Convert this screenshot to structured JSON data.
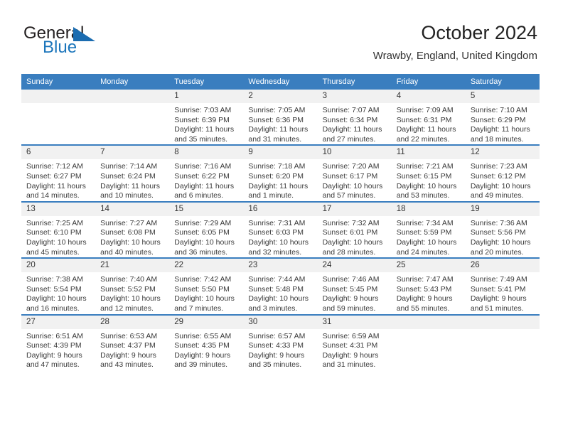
{
  "brand": {
    "name_part1": "General",
    "name_part2": "Blue",
    "accent_color": "#1b75bb"
  },
  "header": {
    "title": "October 2024",
    "subtitle": "Wrawby, England, United Kingdom",
    "header_bg_color": "#3a7ebf",
    "daynum_bg_color": "#f1f1f1"
  },
  "weekday_headers": [
    "Sunday",
    "Monday",
    "Tuesday",
    "Wednesday",
    "Thursday",
    "Friday",
    "Saturday"
  ],
  "labels": {
    "sunrise_prefix": "Sunrise:",
    "sunset_prefix": "Sunset:",
    "daylight_prefix": "Daylight:"
  },
  "weeks": [
    [
      {
        "day": "",
        "blank": true,
        "sunrise": "",
        "sunset": "",
        "daylight_a": "",
        "daylight_b": ""
      },
      {
        "day": "",
        "blank": true,
        "sunrise": "",
        "sunset": "",
        "daylight_a": "",
        "daylight_b": ""
      },
      {
        "day": "1",
        "blank": false,
        "sunrise": "Sunrise: 7:03 AM",
        "sunset": "Sunset: 6:39 PM",
        "daylight_a": "Daylight: 11 hours",
        "daylight_b": "and 35 minutes."
      },
      {
        "day": "2",
        "blank": false,
        "sunrise": "Sunrise: 7:05 AM",
        "sunset": "Sunset: 6:36 PM",
        "daylight_a": "Daylight: 11 hours",
        "daylight_b": "and 31 minutes."
      },
      {
        "day": "3",
        "blank": false,
        "sunrise": "Sunrise: 7:07 AM",
        "sunset": "Sunset: 6:34 PM",
        "daylight_a": "Daylight: 11 hours",
        "daylight_b": "and 27 minutes."
      },
      {
        "day": "4",
        "blank": false,
        "sunrise": "Sunrise: 7:09 AM",
        "sunset": "Sunset: 6:31 PM",
        "daylight_a": "Daylight: 11 hours",
        "daylight_b": "and 22 minutes."
      },
      {
        "day": "5",
        "blank": false,
        "sunrise": "Sunrise: 7:10 AM",
        "sunset": "Sunset: 6:29 PM",
        "daylight_a": "Daylight: 11 hours",
        "daylight_b": "and 18 minutes."
      }
    ],
    [
      {
        "day": "6",
        "blank": false,
        "sunrise": "Sunrise: 7:12 AM",
        "sunset": "Sunset: 6:27 PM",
        "daylight_a": "Daylight: 11 hours",
        "daylight_b": "and 14 minutes."
      },
      {
        "day": "7",
        "blank": false,
        "sunrise": "Sunrise: 7:14 AM",
        "sunset": "Sunset: 6:24 PM",
        "daylight_a": "Daylight: 11 hours",
        "daylight_b": "and 10 minutes."
      },
      {
        "day": "8",
        "blank": false,
        "sunrise": "Sunrise: 7:16 AM",
        "sunset": "Sunset: 6:22 PM",
        "daylight_a": "Daylight: 11 hours",
        "daylight_b": "and 6 minutes."
      },
      {
        "day": "9",
        "blank": false,
        "sunrise": "Sunrise: 7:18 AM",
        "sunset": "Sunset: 6:20 PM",
        "daylight_a": "Daylight: 11 hours",
        "daylight_b": "and 1 minute."
      },
      {
        "day": "10",
        "blank": false,
        "sunrise": "Sunrise: 7:20 AM",
        "sunset": "Sunset: 6:17 PM",
        "daylight_a": "Daylight: 10 hours",
        "daylight_b": "and 57 minutes."
      },
      {
        "day": "11",
        "blank": false,
        "sunrise": "Sunrise: 7:21 AM",
        "sunset": "Sunset: 6:15 PM",
        "daylight_a": "Daylight: 10 hours",
        "daylight_b": "and 53 minutes."
      },
      {
        "day": "12",
        "blank": false,
        "sunrise": "Sunrise: 7:23 AM",
        "sunset": "Sunset: 6:12 PM",
        "daylight_a": "Daylight: 10 hours",
        "daylight_b": "and 49 minutes."
      }
    ],
    [
      {
        "day": "13",
        "blank": false,
        "sunrise": "Sunrise: 7:25 AM",
        "sunset": "Sunset: 6:10 PM",
        "daylight_a": "Daylight: 10 hours",
        "daylight_b": "and 45 minutes."
      },
      {
        "day": "14",
        "blank": false,
        "sunrise": "Sunrise: 7:27 AM",
        "sunset": "Sunset: 6:08 PM",
        "daylight_a": "Daylight: 10 hours",
        "daylight_b": "and 40 minutes."
      },
      {
        "day": "15",
        "blank": false,
        "sunrise": "Sunrise: 7:29 AM",
        "sunset": "Sunset: 6:05 PM",
        "daylight_a": "Daylight: 10 hours",
        "daylight_b": "and 36 minutes."
      },
      {
        "day": "16",
        "blank": false,
        "sunrise": "Sunrise: 7:31 AM",
        "sunset": "Sunset: 6:03 PM",
        "daylight_a": "Daylight: 10 hours",
        "daylight_b": "and 32 minutes."
      },
      {
        "day": "17",
        "blank": false,
        "sunrise": "Sunrise: 7:32 AM",
        "sunset": "Sunset: 6:01 PM",
        "daylight_a": "Daylight: 10 hours",
        "daylight_b": "and 28 minutes."
      },
      {
        "day": "18",
        "blank": false,
        "sunrise": "Sunrise: 7:34 AM",
        "sunset": "Sunset: 5:59 PM",
        "daylight_a": "Daylight: 10 hours",
        "daylight_b": "and 24 minutes."
      },
      {
        "day": "19",
        "blank": false,
        "sunrise": "Sunrise: 7:36 AM",
        "sunset": "Sunset: 5:56 PM",
        "daylight_a": "Daylight: 10 hours",
        "daylight_b": "and 20 minutes."
      }
    ],
    [
      {
        "day": "20",
        "blank": false,
        "sunrise": "Sunrise: 7:38 AM",
        "sunset": "Sunset: 5:54 PM",
        "daylight_a": "Daylight: 10 hours",
        "daylight_b": "and 16 minutes."
      },
      {
        "day": "21",
        "blank": false,
        "sunrise": "Sunrise: 7:40 AM",
        "sunset": "Sunset: 5:52 PM",
        "daylight_a": "Daylight: 10 hours",
        "daylight_b": "and 12 minutes."
      },
      {
        "day": "22",
        "blank": false,
        "sunrise": "Sunrise: 7:42 AM",
        "sunset": "Sunset: 5:50 PM",
        "daylight_a": "Daylight: 10 hours",
        "daylight_b": "and 7 minutes."
      },
      {
        "day": "23",
        "blank": false,
        "sunrise": "Sunrise: 7:44 AM",
        "sunset": "Sunset: 5:48 PM",
        "daylight_a": "Daylight: 10 hours",
        "daylight_b": "and 3 minutes."
      },
      {
        "day": "24",
        "blank": false,
        "sunrise": "Sunrise: 7:46 AM",
        "sunset": "Sunset: 5:45 PM",
        "daylight_a": "Daylight: 9 hours",
        "daylight_b": "and 59 minutes."
      },
      {
        "day": "25",
        "blank": false,
        "sunrise": "Sunrise: 7:47 AM",
        "sunset": "Sunset: 5:43 PM",
        "daylight_a": "Daylight: 9 hours",
        "daylight_b": "and 55 minutes."
      },
      {
        "day": "26",
        "blank": false,
        "sunrise": "Sunrise: 7:49 AM",
        "sunset": "Sunset: 5:41 PM",
        "daylight_a": "Daylight: 9 hours",
        "daylight_b": "and 51 minutes."
      }
    ],
    [
      {
        "day": "27",
        "blank": false,
        "sunrise": "Sunrise: 6:51 AM",
        "sunset": "Sunset: 4:39 PM",
        "daylight_a": "Daylight: 9 hours",
        "daylight_b": "and 47 minutes."
      },
      {
        "day": "28",
        "blank": false,
        "sunrise": "Sunrise: 6:53 AM",
        "sunset": "Sunset: 4:37 PM",
        "daylight_a": "Daylight: 9 hours",
        "daylight_b": "and 43 minutes."
      },
      {
        "day": "29",
        "blank": false,
        "sunrise": "Sunrise: 6:55 AM",
        "sunset": "Sunset: 4:35 PM",
        "daylight_a": "Daylight: 9 hours",
        "daylight_b": "and 39 minutes."
      },
      {
        "day": "30",
        "blank": false,
        "sunrise": "Sunrise: 6:57 AM",
        "sunset": "Sunset: 4:33 PM",
        "daylight_a": "Daylight: 9 hours",
        "daylight_b": "and 35 minutes."
      },
      {
        "day": "31",
        "blank": false,
        "sunrise": "Sunrise: 6:59 AM",
        "sunset": "Sunset: 4:31 PM",
        "daylight_a": "Daylight: 9 hours",
        "daylight_b": "and 31 minutes."
      },
      {
        "day": "",
        "blank": true,
        "sunrise": "",
        "sunset": "",
        "daylight_a": "",
        "daylight_b": ""
      },
      {
        "day": "",
        "blank": true,
        "sunrise": "",
        "sunset": "",
        "daylight_a": "",
        "daylight_b": ""
      }
    ]
  ]
}
